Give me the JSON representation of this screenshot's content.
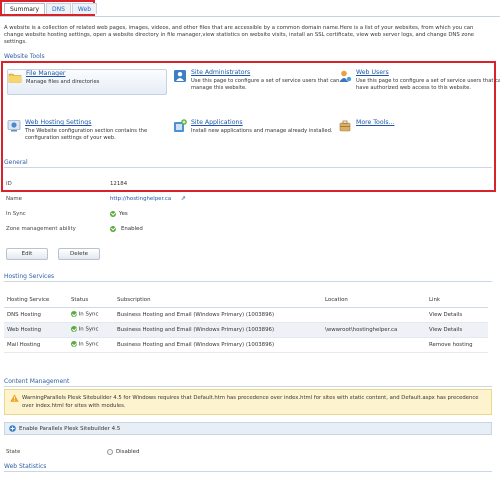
{
  "tabs": [
    {
      "label": "Summary"
    },
    {
      "label": "DNS"
    },
    {
      "label": "Web"
    }
  ],
  "intro": "A website is a collection of related web pages, images, videos, and other files that are accessible by a common domain name.Here is a list of your websites, from which you can change website hosting settings, open a website directory in file manager,view statistics on website visits, install an SSL certificate, view web server logs, and change DNS zone settings.",
  "website_tools": {
    "title": "Website Tools",
    "items": [
      {
        "title": "File Manager",
        "description": "Manage files and directories"
      },
      {
        "title": "Site Administrators",
        "description": "Use this page to configure a set of service users that can manage this website."
      },
      {
        "title": "Web Users",
        "description": "Use this page to configure a set of service users that can have authorized web access to this website."
      },
      {
        "title": "Web Hosting Settings",
        "description": "The Website configuration section contains the configuration settings of your web."
      },
      {
        "title": "Site Applications",
        "description": "Install new applications and manage already installed."
      },
      {
        "title": "More Tools...",
        "description": ""
      }
    ]
  },
  "general": {
    "title": "General",
    "id_label": "ID",
    "id_value": "12184",
    "name_label": "Name",
    "name_value": "http://hostinghelper.ca",
    "insync_label": "In Sync",
    "insync_value": "Yes",
    "zone_label": "Zone management ability",
    "zone_value": "Enabled",
    "edit_label": "Edit",
    "delete_label": "Delete"
  },
  "hosting_services": {
    "title": "Hosting Services",
    "columns": [
      "Hosting Service",
      "Status",
      "Subscription",
      "Location",
      "Link"
    ],
    "rows": [
      {
        "service": "DNS Hosting",
        "status": "In Sync",
        "subscription": "Business Hosting and Email (Windows Primary) (1003896)",
        "location": "",
        "link": "View Details"
      },
      {
        "service": "Web Hosting",
        "status": "In Sync",
        "subscription": "Business Hosting and Email (Windows Primary) (1003896)",
        "location": "\\wwwroot\\hostinghelper.ca",
        "link": "View Details"
      },
      {
        "service": "Mail Hosting",
        "status": "In Sync",
        "subscription": "Business Hosting and Email (Windows Primary) (1003896)",
        "location": "",
        "link": "Remove hosting"
      }
    ]
  },
  "content_management": {
    "title": "Content Management",
    "warning": "WarningParallels Plesk Sitebuilder 4.5 for Windows requires that Default.htm has precedence over index.html for sites with static content, and Default.aspx has precedence over index.html for sites with modules.",
    "enable_label": "Enable Parallels Plesk Sitebuilder 4.5",
    "state_label": "State",
    "state_value": "Disabled"
  },
  "web_statistics": {
    "title": "Web Statistics"
  },
  "colors": {
    "accent": "#2b5ea6",
    "highlight_border": "#d9232a",
    "warning_bg": "#fdf4cf",
    "ok_green": "#5aa93a"
  }
}
